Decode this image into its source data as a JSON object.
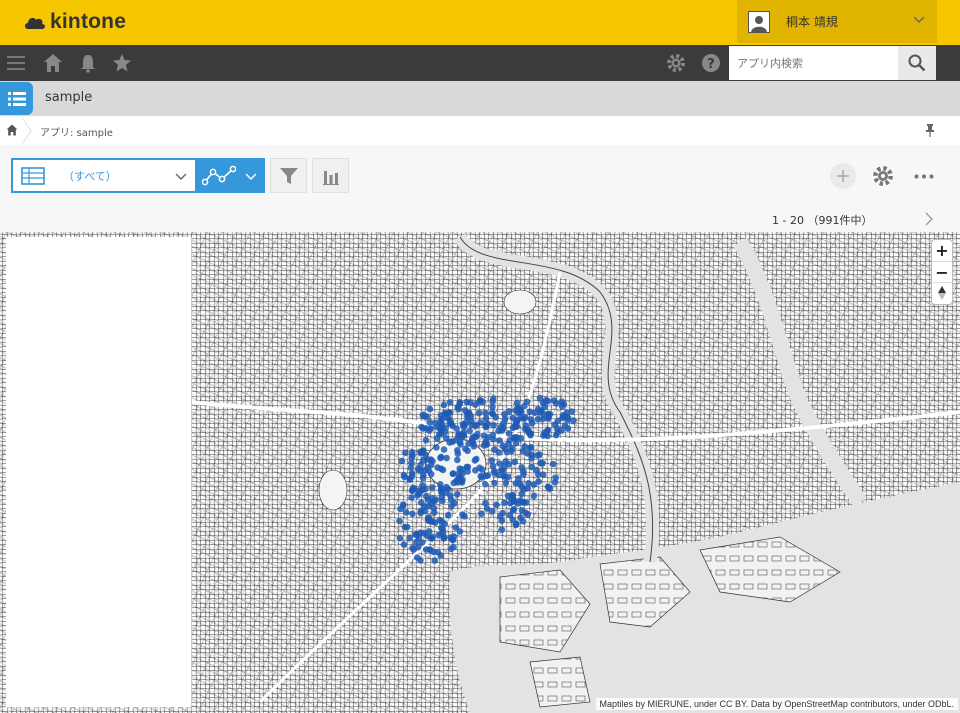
{
  "brand": {
    "name": "kintone"
  },
  "user": {
    "name": "桐本 靖規"
  },
  "search": {
    "placeholder": "アプリ内検索"
  },
  "app": {
    "title": "sample"
  },
  "breadcrumb": {
    "text": "アプリ: sample"
  },
  "view": {
    "selected": "（すべて）"
  },
  "pager": {
    "text": "1 - 20 （991件中）"
  },
  "map": {
    "attribution": "Maptiles by MIERUNE, under CC BY. Data by OpenStreetMap contributors, under ODbL.",
    "zoom_in": "+",
    "zoom_out": "−"
  },
  "colors": {
    "header": "#f6c700",
    "accent": "#3498db",
    "marker": "#1f5bb5"
  }
}
